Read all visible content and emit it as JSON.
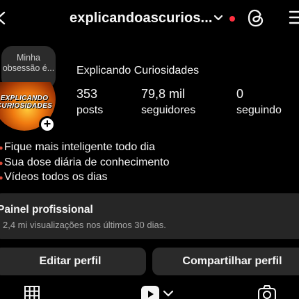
{
  "header": {
    "username": "explicandoascurios...",
    "icons": [
      "back-arrow-icon",
      "chevron-down-icon",
      "notification-dot",
      "threads-icon",
      "menu-icon"
    ],
    "dot_color": "#ff3040"
  },
  "note": {
    "text": "Minha obsessão é..."
  },
  "avatar": {
    "line1": "EXPLICANDO",
    "line2": "CURIOSIDADES"
  },
  "profile": {
    "name": "Explicando Curiosidades",
    "stats": [
      {
        "value": "353",
        "label": "posts"
      },
      {
        "value": "79,8 mil",
        "label": "seguidores"
      },
      {
        "value": "0",
        "label": "seguindo"
      }
    ]
  },
  "bio": [
    "Fique mais inteligente todo dia",
    "Sua dose diária de conhecimento",
    "Vídeos todos os dias"
  ],
  "dashboard": {
    "title": "Painel profissional",
    "subtitle": "2,4 mi visualizações nos últimos 30 dias."
  },
  "actions": {
    "edit": "Editar perfil",
    "share": "Compartilhar perfil"
  },
  "tabs": [
    "grid-icon",
    "reels-icon",
    "tagged-icon"
  ]
}
